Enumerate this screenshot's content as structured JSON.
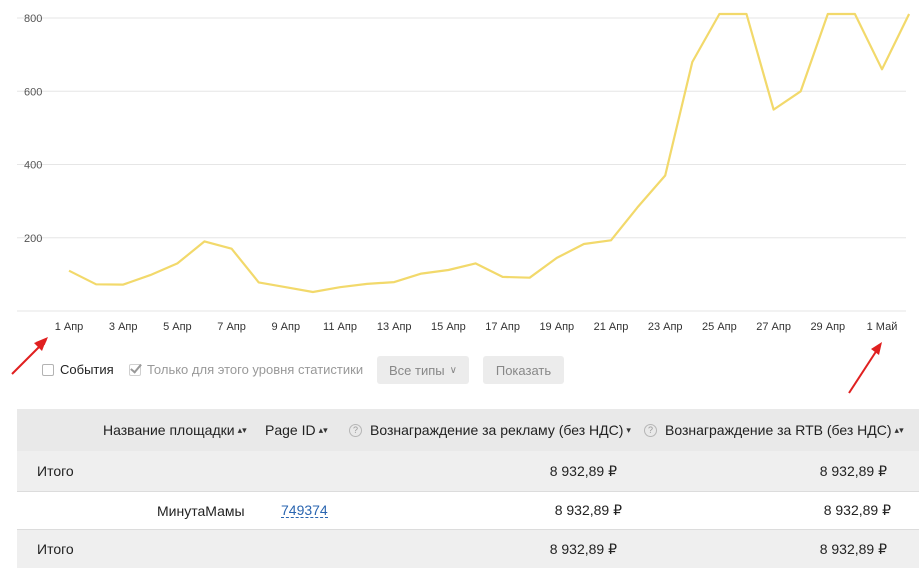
{
  "chart_data": {
    "type": "line",
    "y_ticks": [
      "800",
      "600",
      "400",
      "200"
    ],
    "x_ticks": [
      "1 Апр",
      "3 Апр",
      "5 Апр",
      "7 Апр",
      "9 Апр",
      "11 Апр",
      "13 Апр",
      "15 Апр",
      "17 Апр",
      "19 Апр",
      "21 Апр",
      "23 Апр",
      "25 Апр",
      "27 Апр",
      "29 Апр",
      "1 Май"
    ],
    "series": [
      {
        "values": [
          110,
          73,
          72,
          98,
          130,
          190,
          170,
          78,
          65,
          52,
          65,
          74,
          79,
          102,
          112,
          130,
          93,
          91,
          145,
          183,
          193,
          285,
          370,
          680,
          880,
          870,
          550,
          600,
          880,
          870,
          660,
          900
        ]
      }
    ],
    "ylim": [
      0,
      800
    ],
    "grid": true,
    "line_color": "#f2d96b"
  },
  "controls": {
    "events_label": "События",
    "level_only_label": "Только для этого уровня статистики",
    "types_dropdown_label": "Все типы",
    "show_button_label": "Показать"
  },
  "table": {
    "headers": {
      "site_name": "Название площадки",
      "page_id": "Page ID",
      "ad_reward": "Вознаграждение за рекламу (без НДС)",
      "rtb_reward": "Вознаграждение за RTB (без НДС)"
    },
    "total_top": {
      "label": "Итого",
      "ad_reward": "8 932,89 ₽",
      "rtb_reward": "8 932,89 ₽"
    },
    "rows": [
      {
        "site_name": "МинутаМамы",
        "page_id": "749374",
        "ad_reward": "8 932,89 ₽",
        "rtb_reward": "8 932,89 ₽"
      }
    ],
    "total_bottom": {
      "label": "Итого",
      "ad_reward": "8 932,89 ₽",
      "rtb_reward": "8 932,89 ₽"
    }
  },
  "annotations": {
    "arrow_color": "#e02020"
  }
}
